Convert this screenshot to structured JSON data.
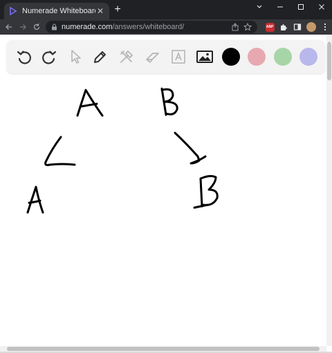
{
  "browser": {
    "tab_title": "Numerade Whiteboard",
    "tab_close": "✕",
    "new_tab": "+",
    "url_host": "numerade.com",
    "url_path": "/answers/whiteboard/",
    "extension_abp": "ABP"
  },
  "toolbar": {
    "colors": {
      "black": "#000000",
      "pink": "#e8a8b0",
      "green": "#a8d5a8",
      "purple": "#b8b8ec"
    }
  },
  "icons": [
    "undo-icon",
    "redo-icon",
    "pointer-icon",
    "pen-icon",
    "tools-icon",
    "eraser-icon",
    "text-icon",
    "image-icon"
  ],
  "canvas_strokes": [
    "A",
    "B",
    "∠",
    "↘",
    "A",
    "B"
  ]
}
